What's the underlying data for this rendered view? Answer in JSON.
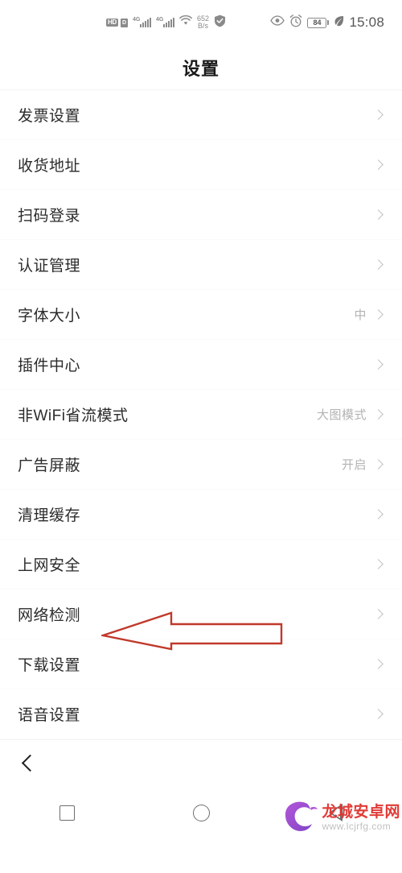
{
  "status_bar": {
    "hd_label": "HD",
    "volte_label": "D",
    "sim1_gen": "4G",
    "sim2_gen": "4G",
    "wifi_icon": "wifi-icon",
    "net_speed_value": "652",
    "net_speed_unit": "B/s",
    "shield_icon": "shield-check-icon",
    "eye_icon": "eye-icon",
    "alarm_icon": "alarm-clock-icon",
    "battery_level": "84",
    "power_saving_icon": "leaf-icon",
    "time": "15:08"
  },
  "header": {
    "title": "设置"
  },
  "settings": {
    "rows": [
      {
        "label": "发票设置",
        "value": ""
      },
      {
        "label": "收货地址",
        "value": ""
      },
      {
        "label": "扫码登录",
        "value": ""
      },
      {
        "label": "认证管理",
        "value": ""
      },
      {
        "label": "字体大小",
        "value": "中"
      },
      {
        "label": "插件中心",
        "value": ""
      },
      {
        "label": "非WiFi省流模式",
        "value": "大图模式"
      },
      {
        "label": "广告屏蔽",
        "value": "开启"
      },
      {
        "label": "清理缓存",
        "value": ""
      },
      {
        "label": "上网安全",
        "value": ""
      },
      {
        "label": "网络检测",
        "value": ""
      },
      {
        "label": "下载设置",
        "value": ""
      },
      {
        "label": "语音设置",
        "value": ""
      }
    ]
  },
  "annotation": {
    "arrow_color": "#c0392b",
    "target_label": "网络检测"
  },
  "back_bar": {
    "back_icon": "chevron-left-icon"
  },
  "nav_bar": {
    "recents_icon": "square-recents-icon",
    "home_icon": "circle-home-icon",
    "back_icon": "triangle-back-icon"
  },
  "watermark": {
    "site_name": "龙城安卓网",
    "site_url": "www.lcjrfg.com",
    "logo_icon": "dragon-c-logo-icon"
  }
}
